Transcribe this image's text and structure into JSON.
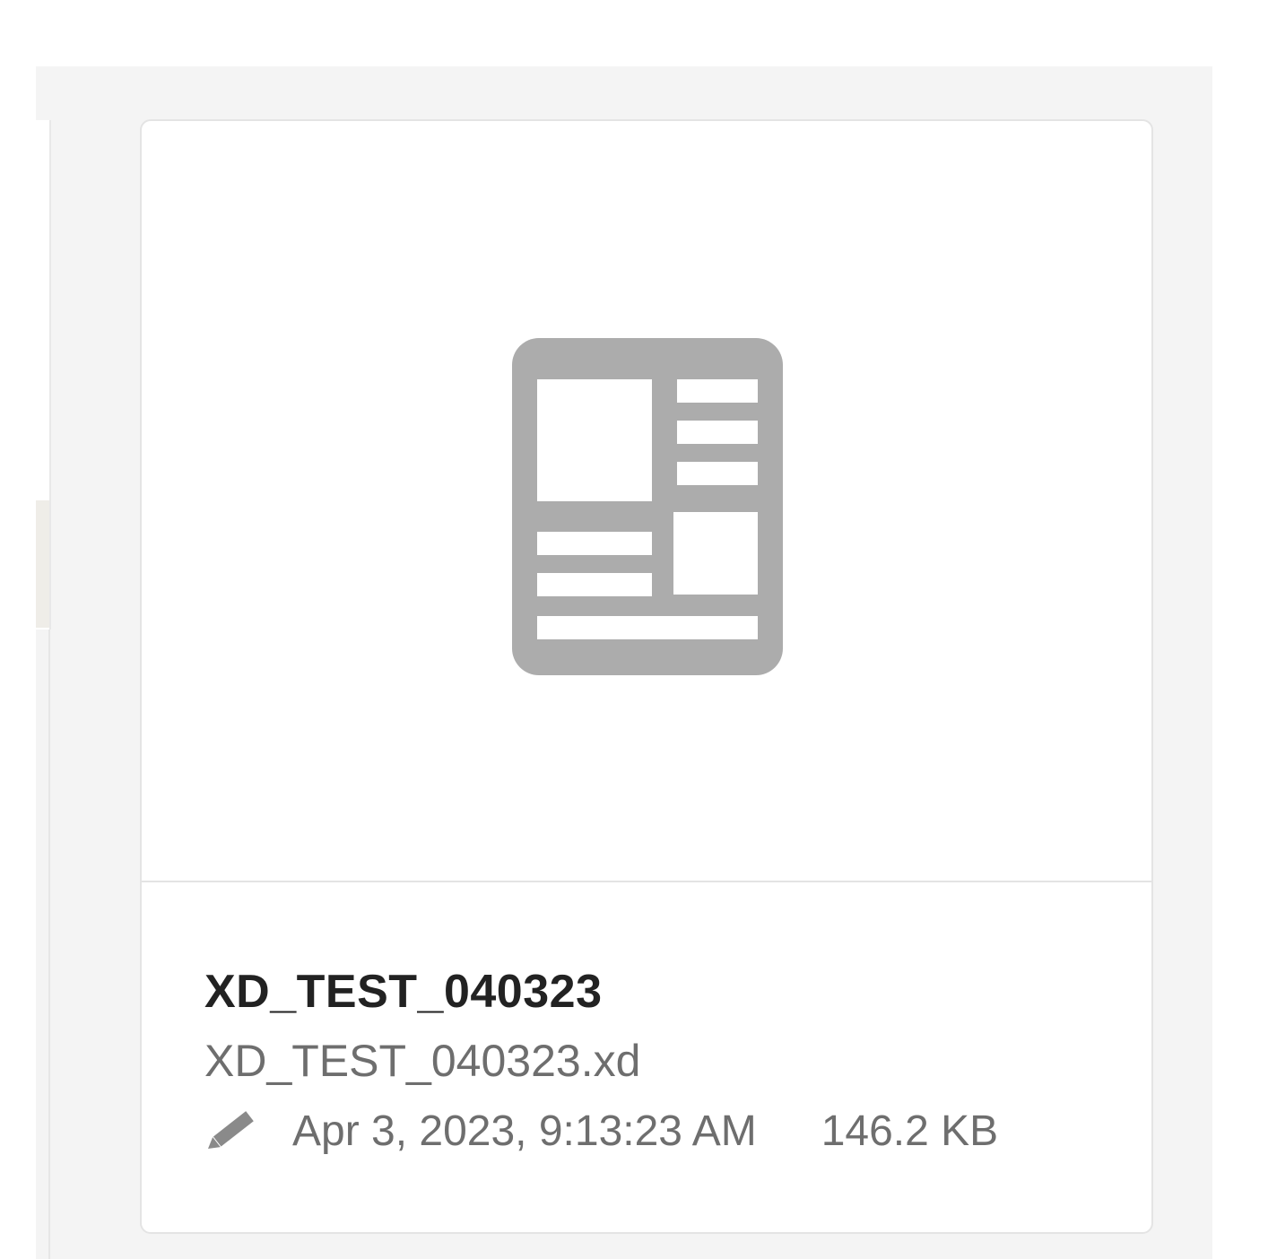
{
  "card": {
    "title": "XD_TEST_040323",
    "filename": "XD_TEST_040323.xd",
    "modified": "Apr 3, 2023, 9:13:23 AM",
    "size": "146.2 KB"
  },
  "icons": {
    "thumbnail": "xd-document-placeholder-icon",
    "modified": "pencil-icon"
  },
  "colors": {
    "icon_gray": "#acacac",
    "panel_bg": "#f4f4f4",
    "card_border": "#e4e4e4",
    "title_text": "#222222",
    "secondary_text": "#6e6e6e"
  }
}
